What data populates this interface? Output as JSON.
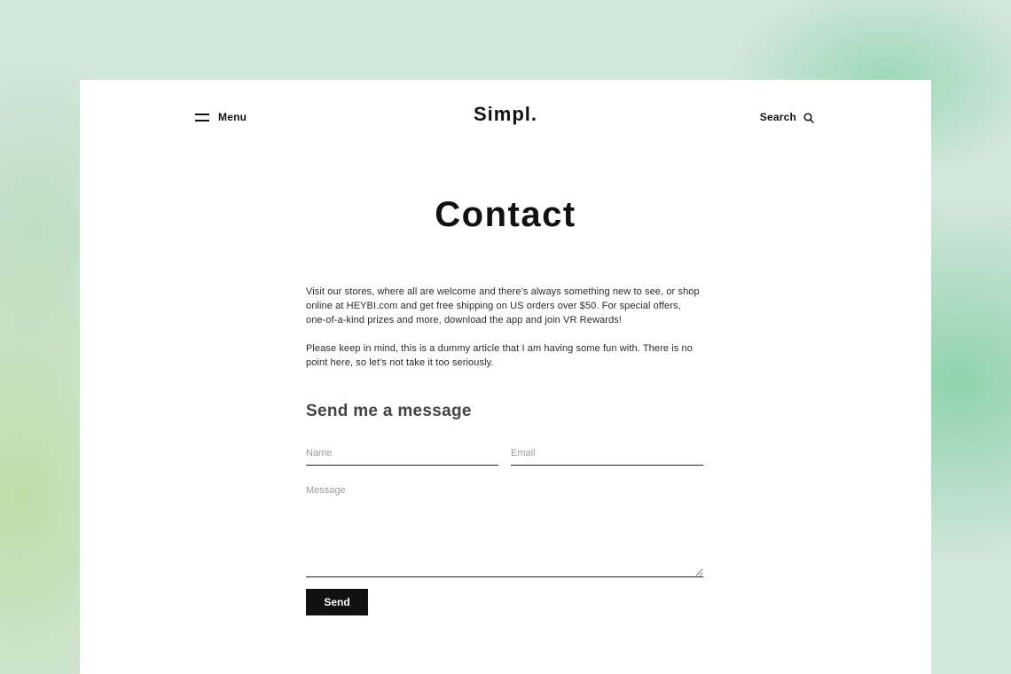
{
  "header": {
    "menu_label": "Menu",
    "menu_icon": "hamburger-icon",
    "logo": "Simpl.",
    "search_label": "Search",
    "search_icon": "search-icon"
  },
  "page": {
    "title": "Contact",
    "paragraphs": [
      "Visit our stores, where all are welcome and there’s always something new to see, or shop online at HEYBI.com and get free shipping on US orders over $50. For special offers, one-of-a-kind prizes and more, download the app and join VR Rewards!",
      "Please keep in mind, this is a dummy article that I am having some fun with. There is no point here, so let’s not take it too seriously."
    ]
  },
  "form": {
    "heading": "Send me a message",
    "name_placeholder": "Name",
    "email_placeholder": "Email",
    "message_placeholder": "Message",
    "send_label": "Send"
  },
  "colors": {
    "background": "#d3e6dc",
    "card": "#ffffff",
    "text": "#111111",
    "button": "#111111"
  }
}
